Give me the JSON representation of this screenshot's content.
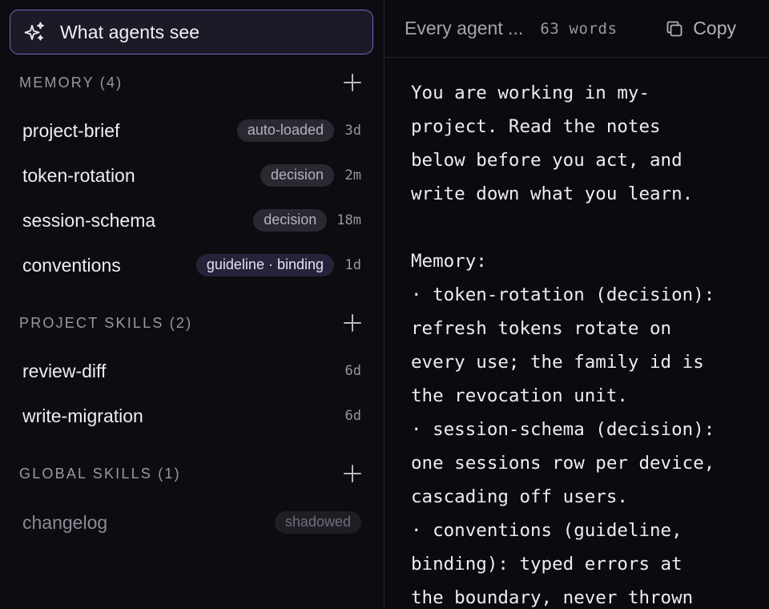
{
  "left_panel": {
    "agents_button_label": "What agents see",
    "sections": {
      "memory": {
        "title": "MEMORY (4)",
        "items": [
          {
            "name": "project-brief",
            "badge": "auto-loaded",
            "age": "3d"
          },
          {
            "name": "token-rotation",
            "badge": "decision",
            "age": "2m"
          },
          {
            "name": "session-schema",
            "badge": "decision",
            "age": "18m"
          },
          {
            "name": "conventions",
            "badge": "guideline · binding",
            "age": "1d"
          }
        ]
      },
      "project_skills": {
        "title": "PROJECT SKILLS (2)",
        "items": [
          {
            "name": "review-diff",
            "age": "6d"
          },
          {
            "name": "write-migration",
            "age": "6d"
          }
        ]
      },
      "global_skills": {
        "title": "GLOBAL SKILLS (1)",
        "items": [
          {
            "name": "changelog",
            "badge": "shadowed"
          }
        ]
      }
    }
  },
  "right_panel": {
    "title": "Every agent ...",
    "word_count": "63 words",
    "copy_label": "Copy",
    "content": "You are working in my-\nproject. Read the notes\nbelow before you act, and\nwrite down what you learn.\n\nMemory:\n· token-rotation (decision):\nrefresh tokens rotate on\nevery use; the family id is\nthe revocation unit.\n· session-schema (decision):\none sessions row per device,\ncascading off users.\n· conventions (guideline,\nbinding): typed errors at\nthe boundary, never thrown"
  },
  "colors": {
    "accent_border": "#7c64c4",
    "background": "#0b0a0e",
    "badge_bg": "#2a2831",
    "badge_guideline_bg": "#27223a"
  }
}
